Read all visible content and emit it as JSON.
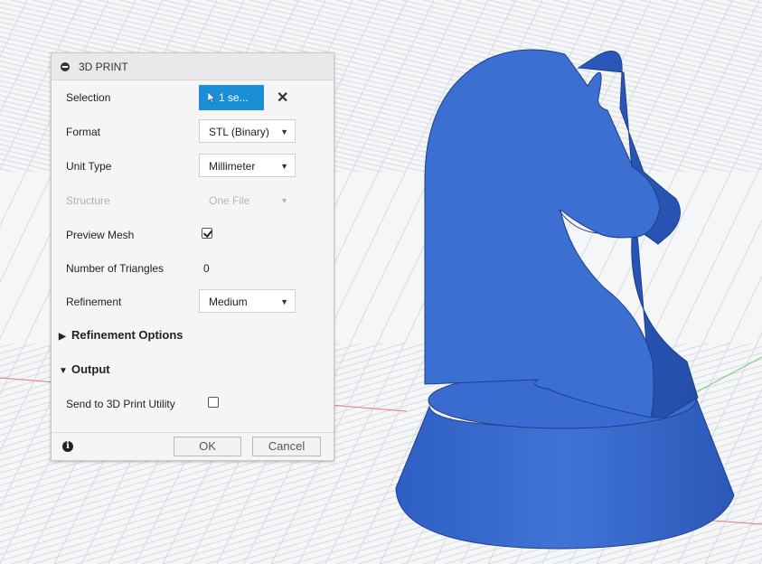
{
  "dialog": {
    "title": "3D PRINT",
    "selection": {
      "label": "Selection",
      "button_text": "1 se...",
      "button_color": "#1b8fd6"
    },
    "format": {
      "label": "Format",
      "value": "STL (Binary)"
    },
    "unit_type": {
      "label": "Unit Type",
      "value": "Millimeter"
    },
    "structure": {
      "label": "Structure",
      "value": "One File",
      "disabled": true
    },
    "preview_mesh": {
      "label": "Preview Mesh",
      "checked": true
    },
    "triangles": {
      "label": "Number of Triangles",
      "value": "0"
    },
    "refinement": {
      "label": "Refinement",
      "value": "Medium"
    },
    "refinement_options": {
      "label": "Refinement Options",
      "expanded": false
    },
    "output": {
      "label": "Output",
      "expanded": true
    },
    "send_to_print": {
      "label": "Send to 3D Print Utility",
      "checked": false
    },
    "ok_label": "OK",
    "cancel_label": "Cancel"
  },
  "icons": {
    "minimize": "minimize-circle-icon",
    "cursor": "cursor-arrow-icon",
    "clear": "close-icon",
    "info": "info-icon",
    "collapsed": "triangle-right-icon",
    "expanded": "triangle-down-icon"
  },
  "viewport": {
    "model": "chess knight",
    "model_color": "#3b6fd1",
    "grid_color": "#d7dbe0",
    "background": "#f4f6f8",
    "axis_red": "#e07a7a",
    "axis_green": "#7ccf7c"
  }
}
